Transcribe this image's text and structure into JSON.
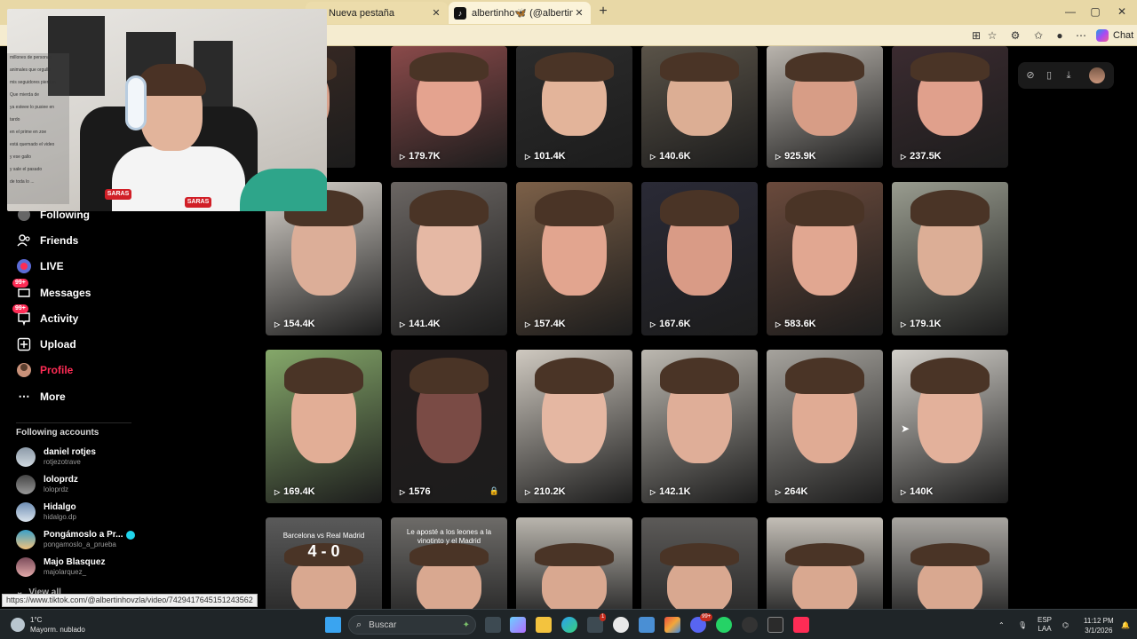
{
  "browser": {
    "tabs": [
      {
        "title": "Nueva pestaña",
        "close": "✕"
      },
      {
        "title": "albertinho🦋 (@albertinhovzla) | T",
        "close": "✕"
      }
    ],
    "new_tab": "+",
    "window": {
      "minimize": "—",
      "maximize": "▢",
      "close": "✕"
    },
    "chat_label": "Chat"
  },
  "sidebar": {
    "nav": [
      {
        "label": "Following",
        "icon": "following-icon"
      },
      {
        "label": "Friends",
        "icon": "friends-icon"
      },
      {
        "label": "LIVE",
        "icon": "live-icon"
      },
      {
        "label": "Messages",
        "icon": "messages-icon",
        "badge": "99+"
      },
      {
        "label": "Activity",
        "icon": "activity-icon",
        "badge": "99+"
      },
      {
        "label": "Upload",
        "icon": "upload-icon"
      },
      {
        "label": "Profile",
        "icon": "profile-avatar",
        "active": true
      },
      {
        "label": "More",
        "icon": "more-icon"
      }
    ],
    "following_title": "Following accounts",
    "accounts": [
      {
        "name": "daniel rotjes",
        "handle": "rotjezotrave"
      },
      {
        "name": "loloprdz",
        "handle": "loloprdz"
      },
      {
        "name": "Hidalgo",
        "handle": "hidalgo.dp"
      },
      {
        "name": "Pongámoslo a Pr...",
        "handle": "pongamoslo_a_prueba",
        "verified": true
      },
      {
        "name": "Majo Blasquez",
        "handle": "majolarquez_"
      }
    ],
    "view_all": "View all"
  },
  "webcam_chat": [
    "millones de personas",
    "animales que orgullo",
    "mis seguidores pierdan",
    "Que mierda de",
    "ya esteee lo pusiee en",
    "tardo",
    "en el prime en zoe",
    "está quemado el video",
    "y ese gallo",
    "y sale el pasado",
    "de toda lo ..."
  ],
  "webcam_logos": [
    "SARAS",
    "SARAS"
  ],
  "videos": [
    {
      "views": "",
      "row": 0
    },
    {
      "views": "179.7K"
    },
    {
      "views": "101.4K"
    },
    {
      "views": "140.6K"
    },
    {
      "views": "925.9K"
    },
    {
      "views": "237.5K"
    },
    {
      "views": "154.4K"
    },
    {
      "views": "141.4K"
    },
    {
      "views": "157.4K"
    },
    {
      "views": "167.6K"
    },
    {
      "views": "583.6K"
    },
    {
      "views": "179.1K"
    },
    {
      "views": "169.4K"
    },
    {
      "views": "1576",
      "locked": true
    },
    {
      "views": "210.2K"
    },
    {
      "views": "142.1K"
    },
    {
      "views": "264K"
    },
    {
      "views": "140K"
    }
  ],
  "bottom_row_captions": {
    "card1_caption": "Barcelona vs Real Madrid",
    "card1_score": "4 - 0",
    "card2_caption": "Le aposté a los leones a la vinotinto y el Madrid"
  },
  "status_url": "https://www.tiktok.com/@albertinhovzla/video/7429417645151243562",
  "taskbar": {
    "weather_temp": "1°C",
    "weather_desc": "Mayorm. nublado",
    "search_placeholder": "Buscar",
    "lang": "ESP",
    "lang2": "LAA",
    "time": "11:12 PM",
    "date": "3/1/2026",
    "badge_discord": "99+",
    "badge_store": "1"
  }
}
